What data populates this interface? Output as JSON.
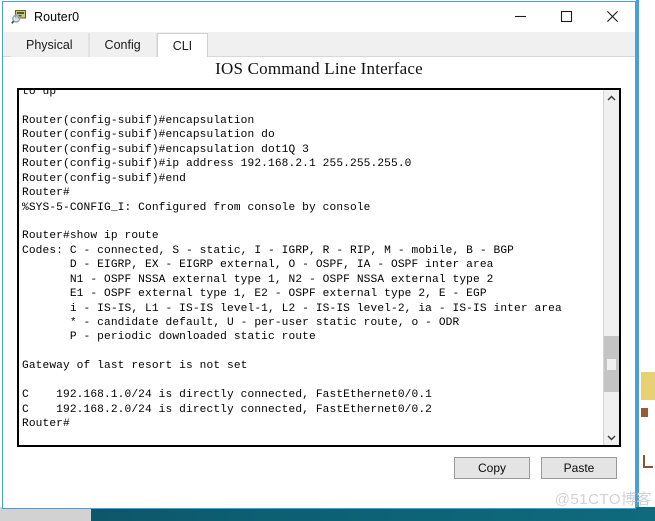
{
  "window": {
    "title": "Router0",
    "icon": "router-magnifier-icon",
    "controls": {
      "minimize": "minimize-icon",
      "maximize": "maximize-icon",
      "close": "close-icon"
    }
  },
  "tabs": [
    {
      "label": "Physical",
      "active": false
    },
    {
      "label": "Config",
      "active": false
    },
    {
      "label": "CLI",
      "active": true
    }
  ],
  "panel": {
    "title": "IOS Command Line Interface"
  },
  "terminal": {
    "lines": [
      "to up",
      "",
      "Router(config-subif)#encapsulation",
      "Router(config-subif)#encapsulation do",
      "Router(config-subif)#encapsulation dot1Q 3",
      "Router(config-subif)#ip address 192.168.2.1 255.255.255.0",
      "Router(config-subif)#end",
      "Router#",
      "%SYS-5-CONFIG_I: Configured from console by console",
      "",
      "Router#show ip route",
      "Codes: C - connected, S - static, I - IGRP, R - RIP, M - mobile, B - BGP",
      "       D - EIGRP, EX - EIGRP external, O - OSPF, IA - OSPF inter area",
      "       N1 - OSPF NSSA external type 1, N2 - OSPF NSSA external type 2",
      "       E1 - OSPF external type 1, E2 - OSPF external type 2, E - EGP",
      "       i - IS-IS, L1 - IS-IS level-1, L2 - IS-IS level-2, ia - IS-IS inter area",
      "       * - candidate default, U - per-user static route, o - ODR",
      "       P - periodic downloaded static route",
      "",
      "Gateway of last resort is not set",
      "",
      "C    192.168.1.0/24 is directly connected, FastEthernet0/0.1",
      "C    192.168.2.0/24 is directly connected, FastEthernet0/0.2",
      "Router#"
    ]
  },
  "scrollbar": {
    "up_arrow": "chevron-up-icon",
    "down_arrow": "chevron-down-icon"
  },
  "buttons": {
    "copy": "Copy",
    "paste": "Paste"
  },
  "watermark": "@51CTO博客"
}
